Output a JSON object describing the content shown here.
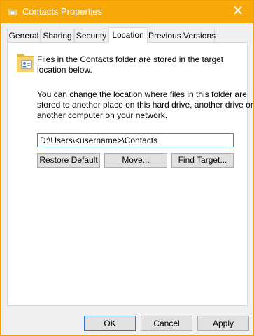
{
  "window": {
    "title": "Contacts Properties",
    "close_glyph": "✕"
  },
  "tabs": [
    {
      "label": "General"
    },
    {
      "label": "Sharing"
    },
    {
      "label": "Security"
    },
    {
      "label": "Location",
      "active": true
    },
    {
      "label": "Previous Versions"
    }
  ],
  "location": {
    "info_line1": "Files in the Contacts folder are stored in the target",
    "info_line2": "location below.",
    "desc_line1": "You can change the location where files in this folder are",
    "desc_line2": "stored to another place on this hard drive, another drive or",
    "desc_line3": "another computer on your network.",
    "path_value": "D:\\Users\\<username>\\Contacts",
    "buttons": {
      "restore_default": "Restore Default",
      "move": "Move...",
      "find_target": "Find Target..."
    }
  },
  "footer": {
    "ok": "OK",
    "cancel": "Cancel",
    "apply": "Apply"
  },
  "icons": {
    "title": "folder-icon",
    "location": "contacts-folder-icon"
  },
  "colors": {
    "titlebar": "#f7a90a",
    "focus_border": "#3b7fd3"
  }
}
